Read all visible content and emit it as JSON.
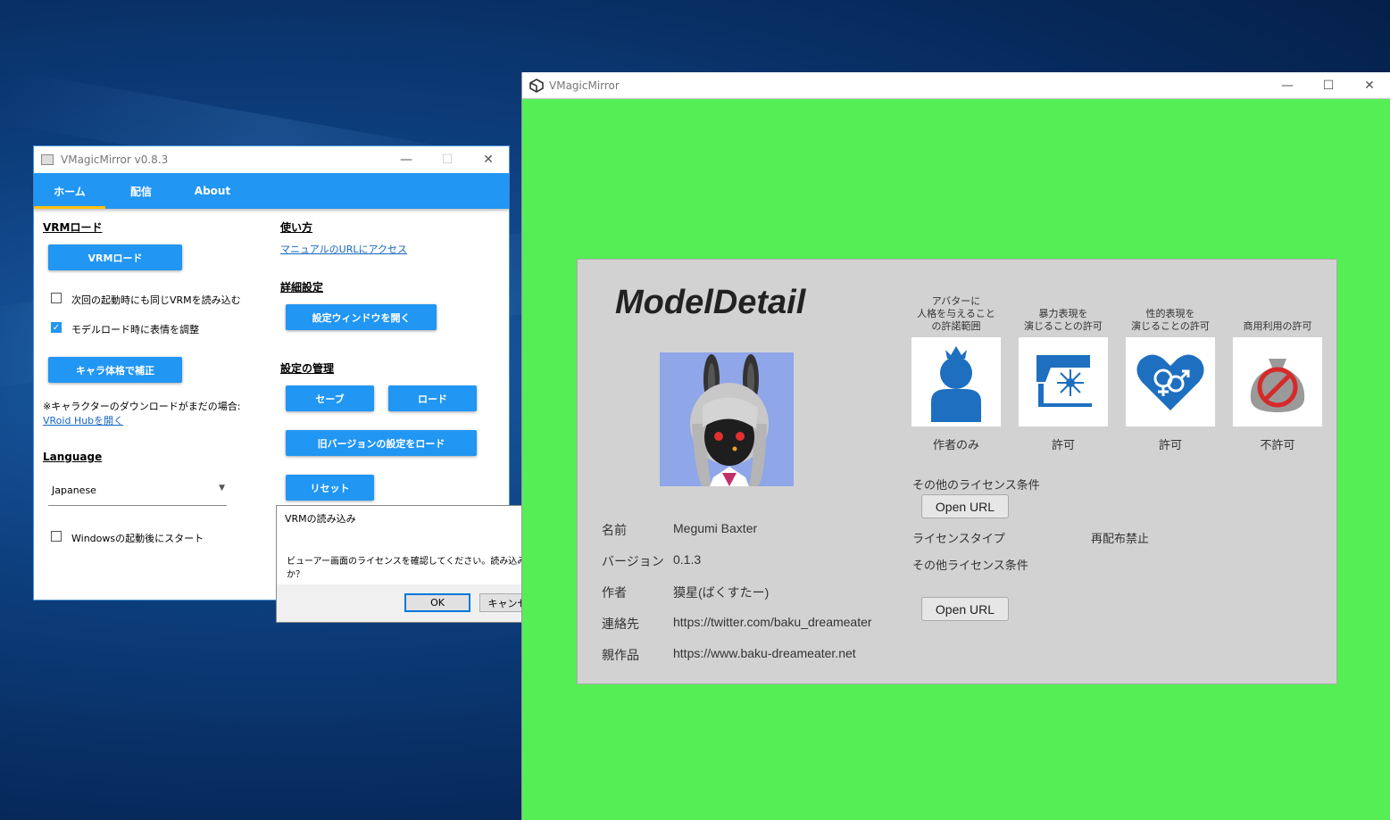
{
  "control_window": {
    "title": "VMagicMirror v0.8.3",
    "tabs": [
      {
        "label": "ホーム",
        "active": true
      },
      {
        "label": "配信",
        "active": false
      },
      {
        "label": "About",
        "active": false
      }
    ],
    "vrm_load": {
      "section": "VRMロード",
      "load_button": "VRMロード",
      "reload_checkbox": {
        "label": "次回の起動時にも同じVRMを読み込む",
        "checked": false
      },
      "expression_checkbox": {
        "label": "モデルロード時に表情を調整",
        "checked": true
      },
      "body_button": "キャラ体格で補正",
      "download_note": "※キャラクターのダウンロードがまだの場合:",
      "vroid_link": "VRoid Hubを開く"
    },
    "language": {
      "section": "Language",
      "selected": "Japanese"
    },
    "startup_checkbox": {
      "label": "Windowsの起動後にスタート",
      "checked": false
    },
    "usage": {
      "section": "使い方",
      "manual_link": "マニュアルのURLにアクセス"
    },
    "detail": {
      "section": "詳細設定",
      "open_settings_button": "設定ウィンドウを開く"
    },
    "management": {
      "section": "設定の管理",
      "save_button": "セーブ",
      "load_button": "ロード",
      "load_old_button": "旧バージョンの設定をロード",
      "reset_button": "リセット"
    }
  },
  "dialog": {
    "title": "VRMの読み込み",
    "message": "ビューアー画面のライセンスを確認してください。読み込みますか？",
    "ok": "OK",
    "cancel": "キャンセル"
  },
  "main_window": {
    "title": "VMagicMirror",
    "background_color": "#55ee55",
    "model_detail": {
      "heading": "ModelDetail",
      "permissions": [
        {
          "header": [
            "アバターに",
            "人格を与えること",
            "の許諾範囲"
          ],
          "icon": "person-crown-icon",
          "value": "作者のみ"
        },
        {
          "header": [
            "暴力表現を",
            "演じることの許可"
          ],
          "icon": "gun-icon",
          "value": "許可"
        },
        {
          "header": [
            "性的表現を",
            "演じることの許可"
          ],
          "icon": "heart-gender-icon",
          "value": "許可"
        },
        {
          "header": [
            "商用利用の許可"
          ],
          "icon": "no-money-bag-icon",
          "value": "不許可"
        }
      ],
      "other_license_label": "その他のライセンス条件",
      "open_url_1": "Open URL",
      "license_type_label": "ライセンスタイプ",
      "license_type_value": "再配布禁止",
      "other_license_label_2": "その他ライセンス条件",
      "open_url_2": "Open URL",
      "info": {
        "name_label": "名前",
        "name": "Megumi Baxter",
        "version_label": "バージョン",
        "version": "0.1.3",
        "author_label": "作者",
        "author": "獏星(ばくすたー)",
        "contact_label": "連絡先",
        "contact": "https://twitter.com/baku_dreameater",
        "reference_label": "親作品",
        "reference": "https://www.baku-dreameater.net"
      }
    }
  }
}
